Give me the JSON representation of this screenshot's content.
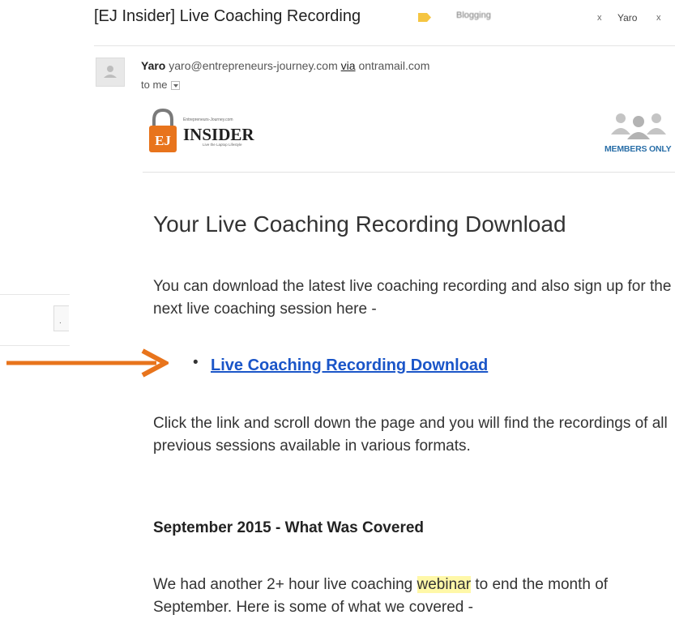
{
  "header": {
    "subject": "[EJ Insider] Live Coaching Recording",
    "tags": {
      "blurred_label": "Blogging",
      "close_symbol": "x",
      "yaro_label": "Yaro"
    },
    "tag_color": "#f5c542"
  },
  "sender": {
    "name": "Yaro",
    "email": "yaro@entrepreneurs-journey.com",
    "via_text": "via",
    "via_domain": "ontramail.com",
    "to_text": "to me"
  },
  "email": {
    "logo": {
      "brand_text": "INSIDER",
      "badge_text": "EJ",
      "tagline": "Entrepreneurs-Journey.com",
      "sub_tagline": "Live the Laptop Lifestyle"
    },
    "members_only": "MEMBERS ONLY",
    "heading": "Your Live Coaching Recording Download",
    "intro": "You can download the latest live coaching recording and also sign up for the next live coaching session here -",
    "bullet": "•",
    "link_text": "Live Coaching Recording Download",
    "instructions": "Click the link and scroll down the page and you will find the recordings of all previous sessions available in various formats.",
    "section_heading": "September 2015 - What Was Covered",
    "recap_before": "We had another 2+ hour live coaching ",
    "recap_highlight": "webinar",
    "recap_after": " to end the month of September. Here is some of what we covered -"
  },
  "colors": {
    "link": "#1a55c8",
    "arrow": "#e8741c",
    "members": "#2a6fa8",
    "logo_orange": "#e8741c",
    "highlight": "#fff8a8"
  }
}
